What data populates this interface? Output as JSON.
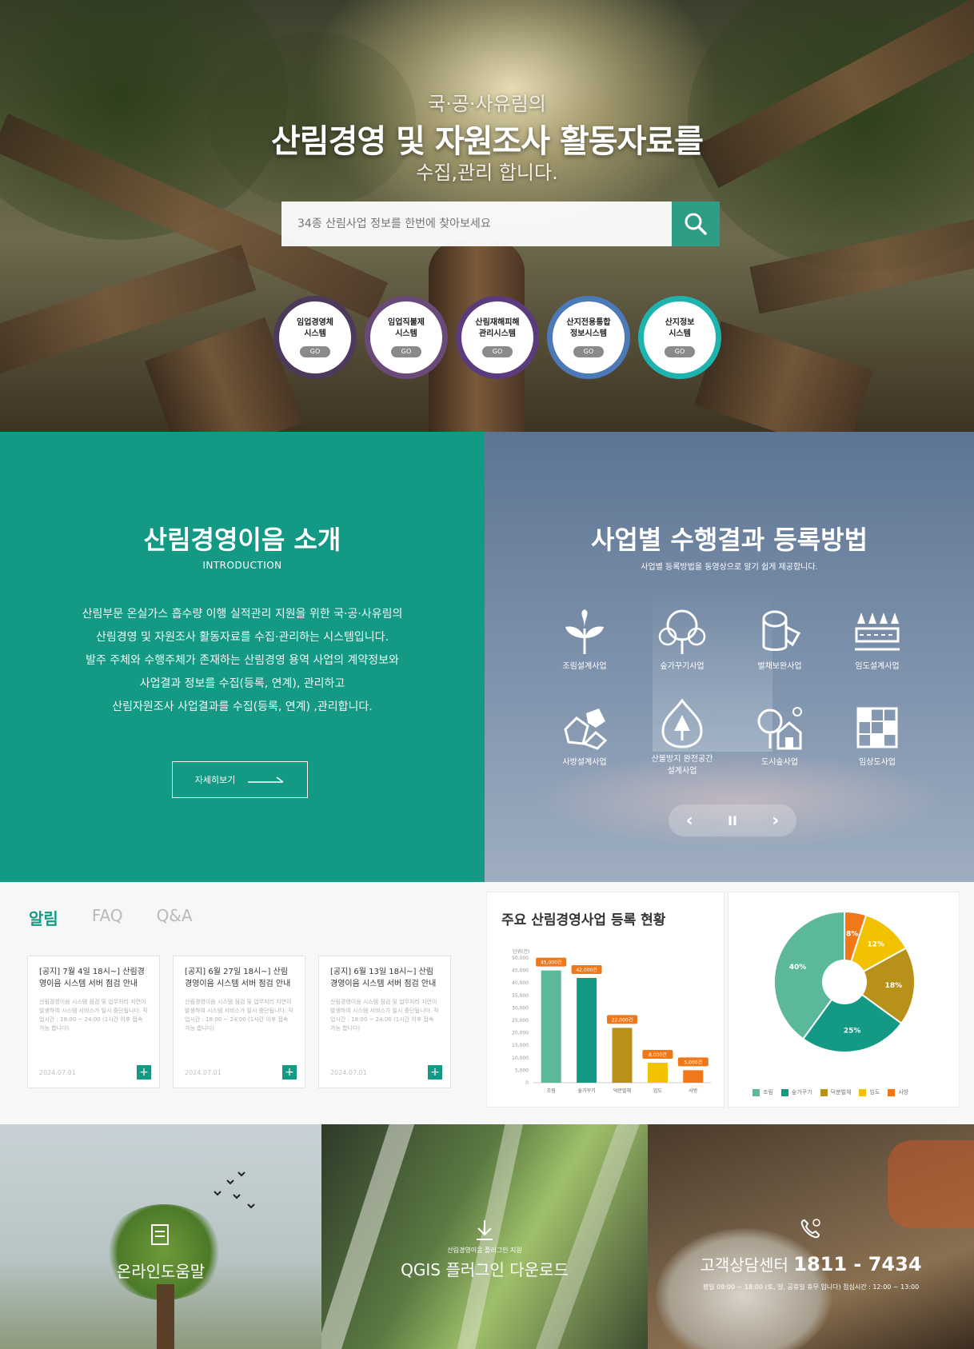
{
  "hero": {
    "line1": "국·공·사유림의",
    "title": "산림경영 및 자원조사 활동자료를",
    "line3": "수집,관리 합니다.",
    "search_placeholder": "34종 산림사업 정보를 한번에 찾아보세요",
    "systems": [
      {
        "name1": "임업경영체",
        "name2": "시스템",
        "go": "GO",
        "ring": "#4d3a5a"
      },
      {
        "name1": "임업직불제",
        "name2": "시스템",
        "go": "GO",
        "ring": "#6a4a78"
      },
      {
        "name1": "산림재해피해",
        "name2": "관리시스템",
        "go": "GO",
        "ring": "#5a3c7c"
      },
      {
        "name1": "산지전용통합",
        "name2": "정보시스템",
        "go": "GO",
        "ring": "#4c7ab8"
      },
      {
        "name1": "산지정보",
        "name2": "시스템",
        "go": "GO",
        "ring": "#1fb3b0"
      }
    ]
  },
  "intro": {
    "title": "산림경영이음 소개",
    "subtitle": "INTRODUCTION",
    "lines": [
      "산림부문 온실가스 흡수량 이행 실적관리 지원을 위한 국·공·사유림의",
      "산림경영 및 자원조사 활동자료를 수집·관리하는 시스템입니다.",
      "발주 주체와 수행주체가 존재하는 산림경영 용역 사업의 계약정보와",
      "사업결과 정보를 수집(등록, 연계), 관리하고",
      "산림자원조사 사업결과를 수집(등록, 연계) ,관리합니다."
    ],
    "more_label": "자세히보기"
  },
  "methods": {
    "title": "사업별 수행결과 등록방법",
    "subtitle": "사업별 등록방법을 동영상으로 알기 쉽게 제공합니다.",
    "items": [
      {
        "label": "조림설계사업",
        "icon": "seedling-icon"
      },
      {
        "label": "숲가꾸기사업",
        "icon": "trees-icon"
      },
      {
        "label": "벌채보완사업",
        "icon": "log-icon"
      },
      {
        "label": "임도설계사업",
        "icon": "forest-road-icon"
      },
      {
        "label": "사방설계사업",
        "icon": "rocks-icon"
      },
      {
        "label": "산불방지 완전공간",
        "label2": "설계사업",
        "icon": "wildfire-icon"
      },
      {
        "label": "도시숲사업",
        "icon": "urban-forest-icon"
      },
      {
        "label": "임상도사업",
        "icon": "grid-map-icon"
      }
    ],
    "ctrl": {
      "prev": "‹",
      "pause": "II",
      "next": "›"
    }
  },
  "notice": {
    "tabs": [
      "알림",
      "FAQ",
      "Q&A"
    ],
    "cards": [
      {
        "title": "[공지] 7월 4일 18시~] 산림경영이음 시스템 서버 점검 안내",
        "body": "산림경영이음 시스템 점검 및 업무처리 지연이 발생하여 시스템 서비스가 일시 중단됩니다. 작업시간 : 18:00 ~ 24:00 (1시간 이후 접속 가능 합니다)",
        "date": "2024.07.01"
      },
      {
        "title": "[공지] 6월 27일 18시~] 산림경영이음 시스템 서버 점검 안내",
        "body": "산림경영이음 시스템 점검 및 업무처리 지연이 발생하여 시스템 서비스가 일시 중단됩니다. 작업시간 : 18:00 ~ 24:00 (1시간 이후 접속 가능 합니다)",
        "date": "2024.07.01"
      },
      {
        "title": "[공지] 6월 13일 18시~] 산림경영이음 시스템 서버 점검 안내",
        "body": "산림경영이음 시스템 점검 및 업무처리 지연이 발생하여 시스템 서비스가 일시 중단됩니다. 작업시간 : 18:00 ~ 24:00 (1시간 이후 접속 가능 합니다)",
        "date": "2024.07.01"
      }
    ]
  },
  "stats": {
    "title": "주요 산림경영사업 등록 현황"
  },
  "chart_data": [
    {
      "type": "bar",
      "title": "주요 산림경영사업 등록 현황",
      "ylabel": "단위(건)",
      "categories": [
        "조림",
        "숲가꾸기",
        "덕분벌채",
        "임도",
        "사방"
      ],
      "values": [
        45000,
        42000,
        22000,
        8000,
        5000
      ],
      "data_labels": [
        "45,000건",
        "42,000건",
        "22,000건",
        "8,000건",
        "5,000건"
      ],
      "colors": [
        "#5bb89a",
        "#149985",
        "#b8911a",
        "#f2c200",
        "#f07818"
      ],
      "yticks": [
        0,
        5000,
        10000,
        15000,
        20000,
        25000,
        30000,
        35000,
        40000,
        45000,
        50000
      ],
      "ylim": [
        0,
        50000
      ]
    },
    {
      "type": "pie",
      "labels": [
        "조림",
        "숲가꾸기",
        "덕분벌채",
        "임도",
        "사방"
      ],
      "values": [
        40,
        25,
        18,
        12,
        5
      ],
      "display": [
        "40%",
        "25%",
        "18%",
        "12%",
        "8%"
      ],
      "colors": [
        "#5bb89a",
        "#149985",
        "#b8911a",
        "#f2c200",
        "#f07818"
      ],
      "legend": "bottom"
    }
  ],
  "bottom": {
    "guide": "온라인도움말",
    "qgis_small": "산림경영이음 플러그인 지원",
    "qgis": "QGIS 플러그인 다운로드",
    "cs_label": "고객상담센터",
    "cs_phone": "1811 - 7434",
    "cs_hours": "평일 09:00 ~ 18:00 (토, 일, 공휴일 휴무 입니다) 점심시간 : 12:00 ~ 13:00"
  }
}
